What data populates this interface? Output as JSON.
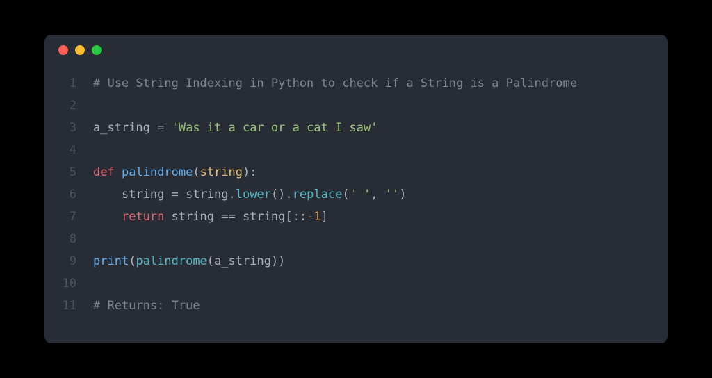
{
  "window": {
    "dots": [
      "red",
      "yellow",
      "green"
    ]
  },
  "code": {
    "lines": [
      {
        "n": "1",
        "tokens": [
          {
            "cls": "c-comment",
            "t": "# Use String Indexing in Python to check if a String is a Palindrome"
          }
        ]
      },
      {
        "n": "2",
        "tokens": []
      },
      {
        "n": "3",
        "tokens": [
          {
            "cls": "c-ident",
            "t": "a_string"
          },
          {
            "cls": "c-op",
            "t": " = "
          },
          {
            "cls": "c-string",
            "t": "'Was it a car or a cat I saw'"
          }
        ]
      },
      {
        "n": "4",
        "tokens": []
      },
      {
        "n": "5",
        "tokens": [
          {
            "cls": "c-def",
            "t": "def "
          },
          {
            "cls": "c-func",
            "t": "palindrome"
          },
          {
            "cls": "c-punct",
            "t": "("
          },
          {
            "cls": "c-var",
            "t": "string"
          },
          {
            "cls": "c-punct",
            "t": "):"
          }
        ]
      },
      {
        "n": "6",
        "tokens": [
          {
            "cls": "c-ident",
            "t": "    string"
          },
          {
            "cls": "c-op",
            "t": " = "
          },
          {
            "cls": "c-ident",
            "t": "string"
          },
          {
            "cls": "c-punct",
            "t": "."
          },
          {
            "cls": "c-call",
            "t": "lower"
          },
          {
            "cls": "c-punct",
            "t": "()."
          },
          {
            "cls": "c-call",
            "t": "replace"
          },
          {
            "cls": "c-punct",
            "t": "("
          },
          {
            "cls": "c-string",
            "t": "' '"
          },
          {
            "cls": "c-punct",
            "t": ", "
          },
          {
            "cls": "c-string",
            "t": "''"
          },
          {
            "cls": "c-punct",
            "t": ")"
          }
        ]
      },
      {
        "n": "7",
        "tokens": [
          {
            "cls": "c-ident",
            "t": "    "
          },
          {
            "cls": "c-def",
            "t": "return"
          },
          {
            "cls": "c-ident",
            "t": " string"
          },
          {
            "cls": "c-op",
            "t": " == "
          },
          {
            "cls": "c-ident",
            "t": "string"
          },
          {
            "cls": "c-punct",
            "t": "[::"
          },
          {
            "cls": "c-num",
            "t": "-1"
          },
          {
            "cls": "c-punct",
            "t": "]"
          }
        ]
      },
      {
        "n": "8",
        "tokens": []
      },
      {
        "n": "9",
        "tokens": [
          {
            "cls": "c-func",
            "t": "print"
          },
          {
            "cls": "c-punct",
            "t": "("
          },
          {
            "cls": "c-call",
            "t": "palindrome"
          },
          {
            "cls": "c-punct",
            "t": "("
          },
          {
            "cls": "c-ident",
            "t": "a_string"
          },
          {
            "cls": "c-punct",
            "t": "))"
          }
        ]
      },
      {
        "n": "10",
        "tokens": []
      },
      {
        "n": "11",
        "tokens": [
          {
            "cls": "c-comment",
            "t": "# Returns: True"
          }
        ]
      }
    ]
  }
}
